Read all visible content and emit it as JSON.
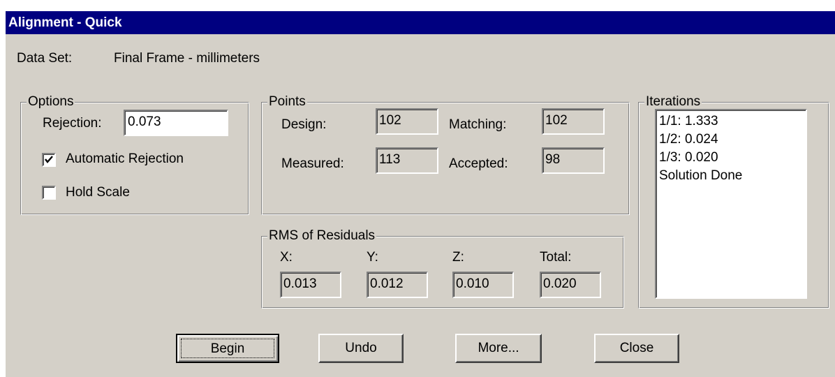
{
  "window": {
    "title": "Alignment - Quick"
  },
  "dataset": {
    "label": "Data Set:",
    "value": "Final Frame - millimeters"
  },
  "options": {
    "title": "Options",
    "rejection_label": "Rejection:",
    "rejection_value": "0.073",
    "auto_rejection_label": "Automatic Rejection",
    "auto_rejection_checked": true,
    "hold_scale_label": "Hold Scale",
    "hold_scale_checked": false
  },
  "points": {
    "title": "Points",
    "design_label": "Design:",
    "design_value": "102",
    "matching_label": "Matching:",
    "matching_value": "102",
    "measured_label": "Measured:",
    "measured_value": "113",
    "accepted_label": "Accepted:",
    "accepted_value": "98"
  },
  "rms": {
    "title": "RMS of Residuals",
    "x_label": "X:",
    "x_value": "0.013",
    "y_label": "Y:",
    "y_value": "0.012",
    "z_label": "Z:",
    "z_value": "0.010",
    "total_label": "Total:",
    "total_value": "0.020"
  },
  "iterations": {
    "title": "Iterations",
    "items": [
      "1/1: 1.333",
      "1/2: 0.024",
      "1/3: 0.020",
      "Solution Done"
    ]
  },
  "buttons": {
    "begin": "Begin",
    "undo": "Undo",
    "more": "More...",
    "close": "Close"
  }
}
